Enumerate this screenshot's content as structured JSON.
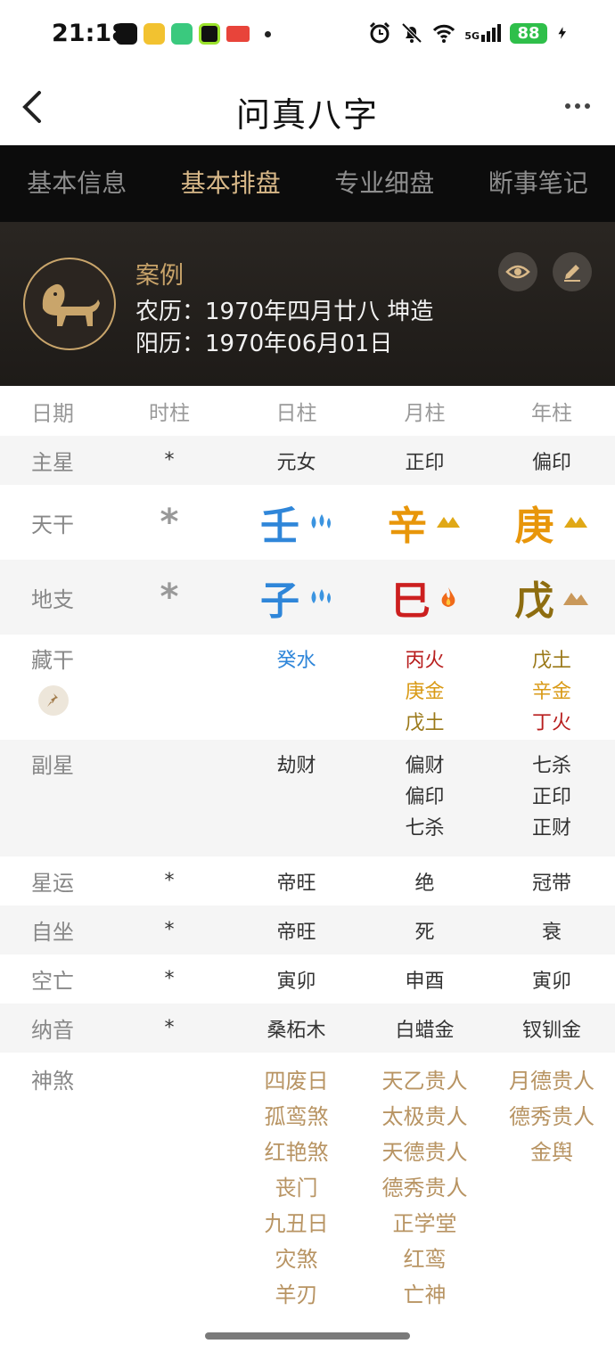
{
  "status": {
    "time": "21:18",
    "battery": "88",
    "signal": "5G"
  },
  "nav": {
    "title": "问真八字"
  },
  "tabs": [
    "基本信息",
    "基本排盘",
    "专业细盘",
    "断事笔记"
  ],
  "profile": {
    "name": "案例",
    "lunar": "农历：1970年四月廿八 坤造",
    "solar": "阳历：1970年06月01日"
  },
  "table": {
    "header": [
      "日期",
      "时柱",
      "日柱",
      "月柱",
      "年柱"
    ],
    "zhuxing": {
      "label": "主星",
      "values": [
        "*",
        "元女",
        "正印",
        "偏印"
      ]
    },
    "tiangan": {
      "label": "天干",
      "hour": "*",
      "day": "壬",
      "month": "辛",
      "year": "庚"
    },
    "dizhi": {
      "label": "地支",
      "hour": "*",
      "day": "子",
      "month": "巳",
      "year": "戊"
    },
    "canggan": {
      "label": "藏干",
      "day": [
        "癸水"
      ],
      "month": [
        "丙火",
        "庚金",
        "戊土"
      ],
      "year": [
        "戊土",
        "辛金",
        "丁火"
      ]
    },
    "fuxing": {
      "label": "副星",
      "day": [
        "劫财"
      ],
      "month": [
        "偏财",
        "偏印",
        "七杀"
      ],
      "year": [
        "七杀",
        "正印",
        "正财"
      ]
    },
    "xingyun": {
      "label": "星运",
      "values": [
        "*",
        "帝旺",
        "绝",
        "冠带"
      ]
    },
    "zizuo": {
      "label": "自坐",
      "values": [
        "*",
        "帝旺",
        "死",
        "衰"
      ]
    },
    "kongwang": {
      "label": "空亡",
      "values": [
        "*",
        "寅卯",
        "申酉",
        "寅卯"
      ]
    },
    "nayin": {
      "label": "纳音",
      "values": [
        "*",
        "桑柘木",
        "白蜡金",
        "钗钏金"
      ]
    },
    "shensha": {
      "label": "神煞",
      "day": [
        "四废日",
        "孤鸾煞",
        "红艳煞",
        "丧门",
        "九丑日",
        "灾煞",
        "羊刃"
      ],
      "month": [
        "天乙贵人",
        "太极贵人",
        "天德贵人",
        "德秀贵人",
        "正学堂",
        "红鸾",
        "亡神"
      ],
      "year": [
        "月德贵人",
        "德秀贵人",
        "金舆"
      ]
    }
  },
  "colors": {
    "accent": "#d9b989",
    "tabbar": "#0c0c0c",
    "shensha": "#b89463"
  }
}
